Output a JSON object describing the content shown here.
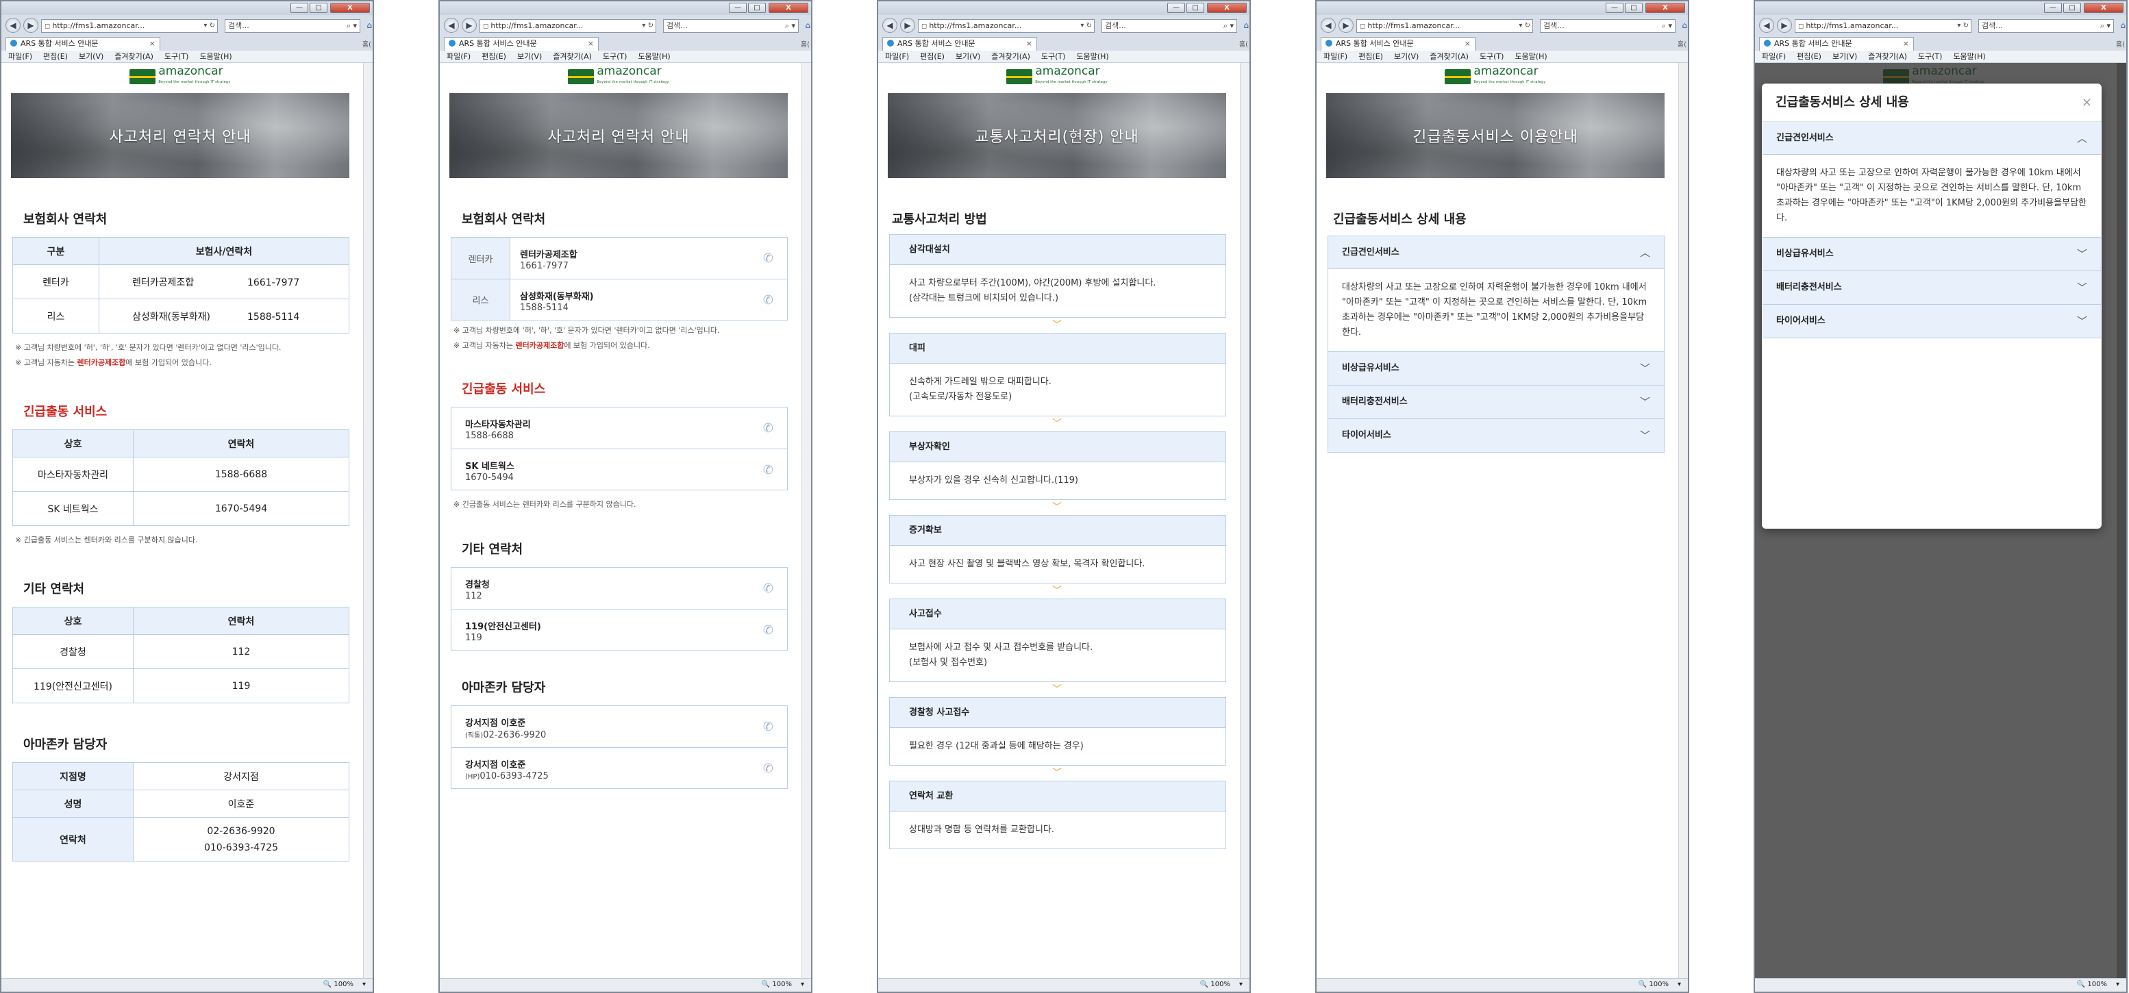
{
  "browser": {
    "url": "http://fms1.amazoncar...",
    "search_placeholder": "검색...",
    "tab_title": "ARS 통합 서비스 안내문",
    "tab_side": "홈(",
    "menu": [
      "파일(F)",
      "편집(E)",
      "보기(V)",
      "즐겨찾기(A)",
      "도구(T)",
      "도움말(H)"
    ],
    "zoom": "100%",
    "close_label": "X",
    "min_label": "—",
    "max_label": "□"
  },
  "brand": {
    "name": "amazoncar",
    "tagline": "Beyond the market through IT strategy"
  },
  "screen1": {
    "hero": "사고처리 연락처 안내",
    "insurance_title": "보험회사 연락처",
    "insurance_headers": [
      "구분",
      "보험사/연락처"
    ],
    "insurance_rows": [
      {
        "type": "렌터카",
        "company": "렌터카공제조합",
        "phone": "1661-7977"
      },
      {
        "type": "리스",
        "company": "삼성화재(동부화재)",
        "phone": "1588-5114"
      }
    ],
    "note1": "※ 고객님 차량번호에 '허', '하', '호' 문자가 있다면 '렌터카'이고 없다면 '리스'입니다.",
    "note2_pre": "※ 고객님 자동차는 ",
    "note2_em": "렌터카공제조합",
    "note2_post": "에 보험 가입되어 있습니다.",
    "emergency_title": "긴급출동 서비스",
    "emergency_headers": [
      "상호",
      "연락처"
    ],
    "emergency_rows": [
      {
        "name": "마스타자동차관리",
        "phone": "1588-6688"
      },
      {
        "name": "SK 네트웍스",
        "phone": "1670-5494"
      }
    ],
    "emergency_note": "※ 긴급출동 서비스는 렌터카와 리스를 구분하지 않습니다.",
    "other_title": "기타 연락처",
    "other_headers": [
      "상호",
      "연락처"
    ],
    "other_rows": [
      {
        "name": "경찰청",
        "phone": "112"
      },
      {
        "name": "119(안전신고센터)",
        "phone": "119"
      }
    ],
    "manager_title": "아마존카 담당자",
    "manager": {
      "branch_label": "지점명",
      "branch": "강서지점",
      "name_label": "성명",
      "name": "이호준",
      "contact_label": "연락처",
      "phone1": "02-2636-9920",
      "phone2": "010-6393-4725"
    }
  },
  "screen2": {
    "hero": "사고처리 연락처 안내",
    "insurance_title": "보험회사 연락처",
    "insurance_rows": [
      {
        "type": "렌터카",
        "company": "렌터카공제조합",
        "phone": "1661-7977"
      },
      {
        "type": "리스",
        "company": "삼성화재(동부화재)",
        "phone": "1588-5114"
      }
    ],
    "note1": "※ 고객님 차량번호에 '허', '하', '호' 문자가 있다면 '렌터카'이고 없다면 '리스'입니다.",
    "note2_pre": "※ 고객님 자동차는 ",
    "note2_em": "렌터카공제조합",
    "note2_post": "에 보험 가입되어 있습니다.",
    "emergency_title": "긴급출동 서비스",
    "emergency_rows": [
      {
        "name": "마스타자동차관리",
        "phone": "1588-6688"
      },
      {
        "name": "SK 네트웍스",
        "phone": "1670-5494"
      }
    ],
    "emergency_note": "※ 긴급출동 서비스는 렌터카와 리스를 구분하지 않습니다.",
    "other_title": "기타 연락처",
    "other_rows": [
      {
        "name": "경찰청",
        "phone": "112"
      },
      {
        "name": "119(안전신고센터)",
        "phone": "119"
      }
    ],
    "manager_title": "아마존카 담당자",
    "manager_rows": [
      {
        "name": "강서지점 이호준",
        "prefix": "(직통)",
        "phone": "02-2636-9920"
      },
      {
        "name": "강서지점 이호준",
        "prefix": "(HP)",
        "phone": "010-6393-4725"
      }
    ]
  },
  "screen3": {
    "hero": "교통사고처리(현장) 안내",
    "title": "교통사고처리 방법",
    "steps": [
      {
        "title": "삼각대설치",
        "l1": "사고 차량으로부터 주간(100M), 야간(200M) 후방에 설치합니다.",
        "l2": "(삼각대는 트렁크에 비치되어 있습니다.)"
      },
      {
        "title": "대피",
        "l1": "신속하게 가드레일 밖으로 대피합니다.",
        "l2": "(고속도로/자동차 전용도로)"
      },
      {
        "title": "부상자확인",
        "l1": "부상자가 있을 경우 신속히 신고합니다.(119)",
        "l2": ""
      },
      {
        "title": "증거확보",
        "l1": "사고 현장 사진 촬영 및 블랙박스 영상 확보, 목격자 확인합니다.",
        "l2": ""
      },
      {
        "title": "사고접수",
        "l1": "보험사에 사고 접수 및 사고 접수번호를 받습니다.",
        "l2": "(보험사 및 접수번호)"
      },
      {
        "title": "경찰청 사고접수",
        "l1": "필요한 경우 (12대 중과실 등에 해당하는 경우)",
        "l2": ""
      },
      {
        "title": "연락처 교환",
        "l1": "상대방과 명함 등 연락처를 교환합니다.",
        "l2": ""
      }
    ]
  },
  "screen4": {
    "hero": "긴급출동서비스 이용안내",
    "title": "긴급출동서비스 상세 내용",
    "items": [
      "긴급견인서비스",
      "비상급유서비스",
      "배터리충전서비스",
      "타이어서비스"
    ],
    "detail": "대상차량의 사고 또는 고장으로 인하여 자력운행이 불가능한 경우에 10km 내에서 \"아마존카\" 또는 \"고객\" 이 지정하는 곳으로 견인하는 서비스를 말한다. 단, 10km 초과하는 경우에는 \"아마존카\" 또는 \"고객\"이 1KM당 2,000원의 추가비용을부담한다."
  },
  "screen5": {
    "modal_title": "긴급출동서비스 상세 내용",
    "close": "×",
    "items": [
      "긴급견인서비스",
      "비상급유서비스",
      "배터리충전서비스",
      "타이어서비스"
    ],
    "detail": "대상차량의 사고 또는 고장으로 인하여 자력운행이 불가능한 경우에 10km 내에서 \"아마존카\" 또는 \"고객\" 이 지정하는 곳으로 견인하는 서비스를 말한다. 단, 10km 초과하는 경우에는 \"아마존카\" 또는 \"고객\"이 1KM당 2,000원의 추가비용을부담한다."
  }
}
